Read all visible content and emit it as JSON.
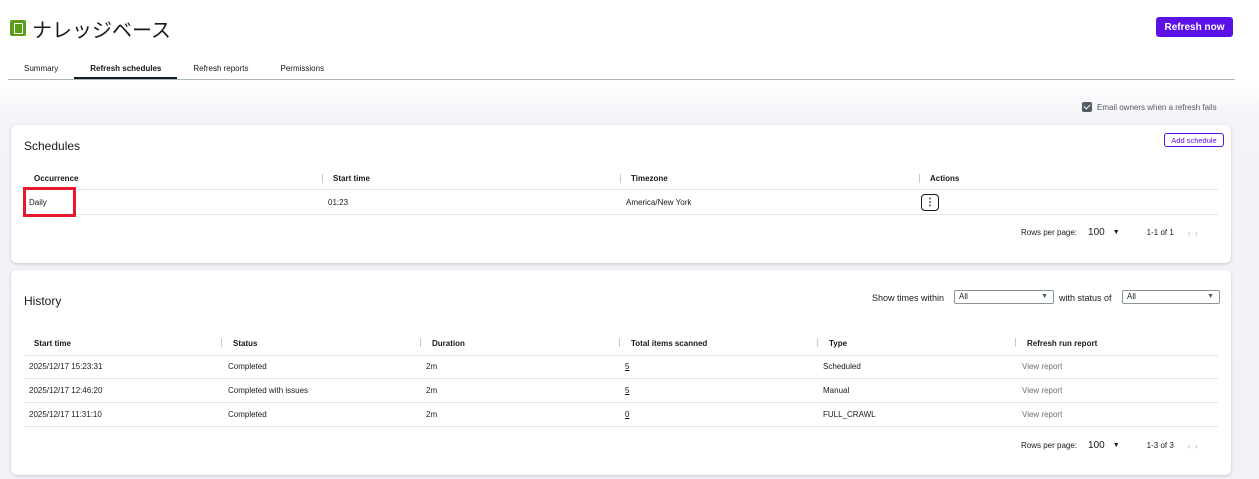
{
  "header": {
    "title": "ナレッジベース",
    "refresh_now": "Refresh now"
  },
  "tabs": [
    {
      "label": "Summary"
    },
    {
      "label": "Refresh schedules"
    },
    {
      "label": "Refresh reports"
    },
    {
      "label": "Permissions"
    }
  ],
  "email_option": {
    "label": "Email owners when a refresh fails",
    "checked": true
  },
  "schedules": {
    "title": "Schedules",
    "add_label": "Add schedule",
    "columns": [
      "Occurrence",
      "Start time",
      "Timezone",
      "Actions"
    ],
    "rows": [
      {
        "occurrence": "Daily",
        "start_time": "01:23",
        "timezone": "America/New York",
        "actions_icon": "more-vertical-icon"
      }
    ],
    "pager": {
      "label": "Rows per page:",
      "value": "100",
      "range": "1-1 of 1"
    }
  },
  "history": {
    "title": "History",
    "filter_within_label": "Show times within",
    "filter_within_value": "All",
    "filter_status_label": "with status of",
    "filter_status_value": "All",
    "columns": [
      "Start time",
      "Status",
      "Duration",
      "Total items scanned",
      "Type",
      "Refresh run report"
    ],
    "rows": [
      {
        "start": "2025/12/17 15:23:31",
        "status": "Completed",
        "duration": "2m",
        "items": "5",
        "type": "Scheduled",
        "report": "View report"
      },
      {
        "start": "2025/12/17 12:46:20",
        "status": "Completed with issues",
        "duration": "2m",
        "items": "5",
        "type": "Manual",
        "report": "View report"
      },
      {
        "start": "2025/12/17 11:31:10",
        "status": "Completed",
        "duration": "2m",
        "items": "0",
        "type": "FULL_CRAWL",
        "report": "View report"
      }
    ],
    "pager": {
      "label": "Rows per page:",
      "value": "100",
      "range": "1-3 of 3"
    }
  },
  "colors": {
    "accent": "#5b10e6",
    "highlight": "#e8192c",
    "logo": "#5a9e1a"
  }
}
